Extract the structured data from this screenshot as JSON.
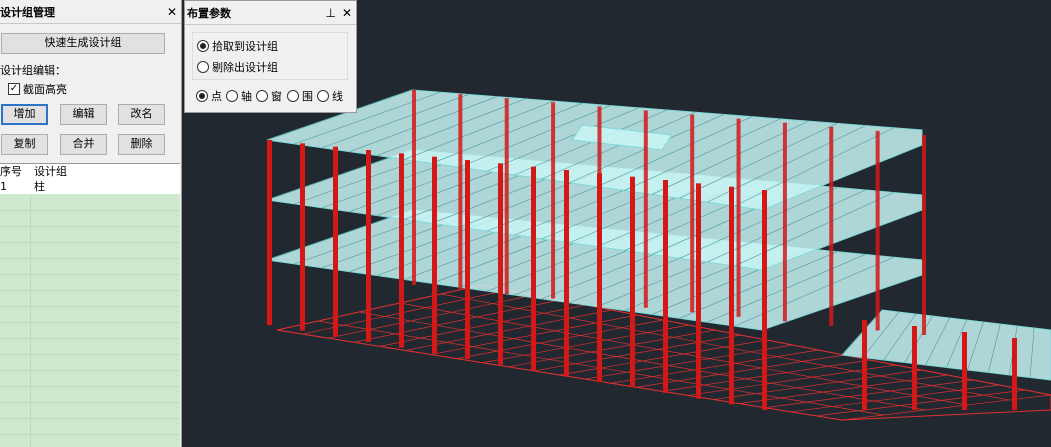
{
  "left_panel": {
    "title": "设计组管理",
    "close_glyph": "✕",
    "quick_generate": "快速生成设计组",
    "edit_label": "设计组编辑：",
    "highlight_checkbox": {
      "label": "截面高亮",
      "checked": true,
      "glyph": "✓"
    },
    "buttons_row1": [
      "增加",
      "编辑",
      "改名"
    ],
    "buttons_row2": [
      "复制",
      "合并",
      "删除"
    ],
    "list": {
      "headers": [
        "序号",
        "设计组"
      ],
      "rows": [
        {
          "index": "1",
          "name": "柱"
        }
      ]
    }
  },
  "dialog": {
    "title": "布置参数",
    "pin_glyph": "⊥",
    "close_glyph": "✕",
    "mode_options": [
      {
        "label": "拾取到设计组",
        "selected": true
      },
      {
        "label": "剔除出设计组",
        "selected": false
      }
    ],
    "pick_options": [
      {
        "label": "点",
        "selected": true
      },
      {
        "label": "轴",
        "selected": false
      },
      {
        "label": "窗",
        "selected": false
      },
      {
        "label": "围",
        "selected": false
      },
      {
        "label": "线",
        "selected": false
      }
    ]
  },
  "viewport": {
    "background": "#212830",
    "beam_color": "#c8f4f4",
    "column_color": "#d41818",
    "ground_color": "#e03030"
  }
}
